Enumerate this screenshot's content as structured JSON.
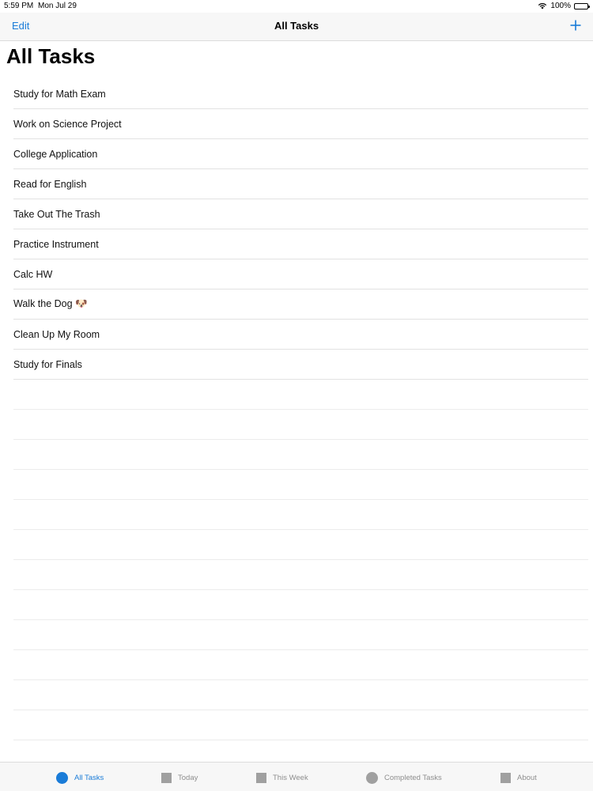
{
  "status_bar": {
    "time": "5:59 PM",
    "date": "Mon Jul 29",
    "battery": "100%",
    "wifi_icon": "wifi-icon",
    "battery_icon": "battery-icon"
  },
  "nav": {
    "edit_label": "Edit",
    "title": "All Tasks",
    "add_icon": "plus-icon"
  },
  "page": {
    "large_title": "All Tasks"
  },
  "tasks": [
    "Study for Math Exam",
    "Work on Science Project",
    "College Application",
    "Read for English",
    "Take Out The Trash",
    "Practice Instrument",
    "Calc HW",
    "Walk the Dog 🐶",
    "Clean Up My Room",
    "Study for Finals"
  ],
  "tab_bar": {
    "tabs": [
      {
        "label": "All Tasks",
        "icon": "circle",
        "active": true
      },
      {
        "label": "Today",
        "icon": "square",
        "active": false
      },
      {
        "label": "This Week",
        "icon": "square",
        "active": false
      },
      {
        "label": "Completed Tasks",
        "icon": "circle",
        "active": false
      },
      {
        "label": "About",
        "icon": "square",
        "active": false
      }
    ]
  },
  "colors": {
    "accent": "#1a7cd8",
    "inactive": "#8e8e8e",
    "bar_background": "#f7f7f7"
  }
}
